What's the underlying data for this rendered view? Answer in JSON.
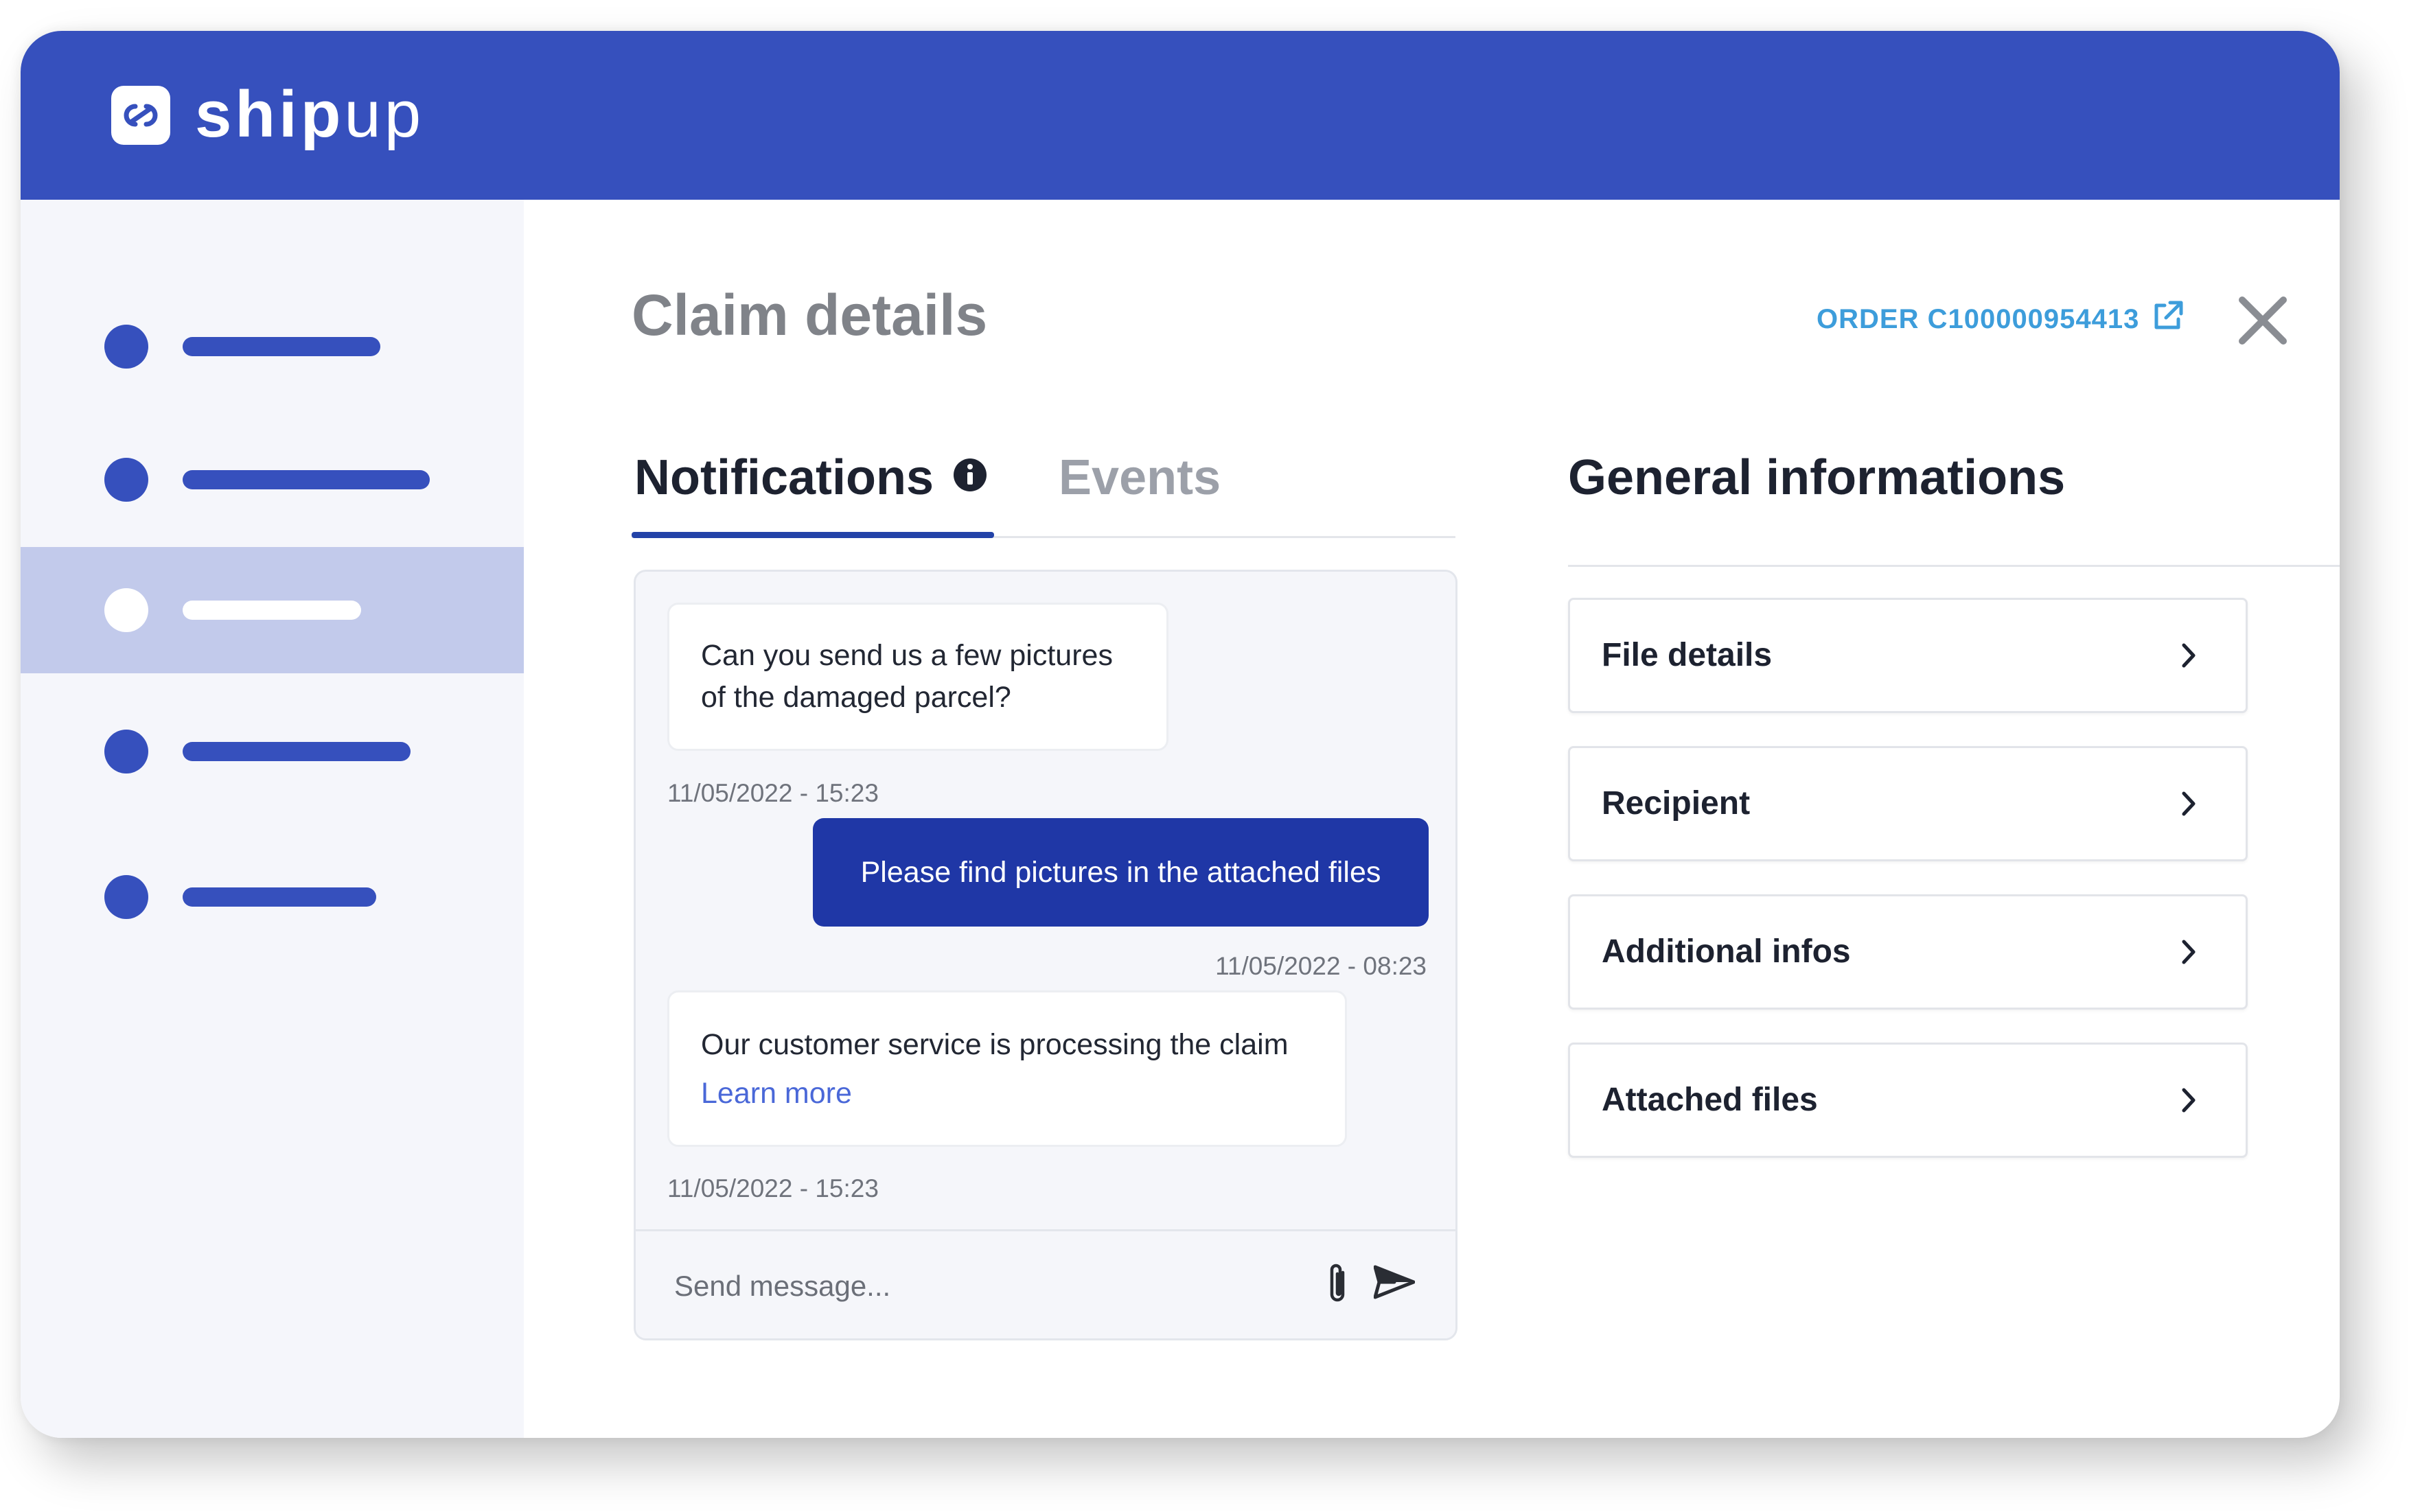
{
  "brand": {
    "name_bold": "ship",
    "name_light": "up",
    "primary_color": "#3650bd",
    "accent_color": "#1f37a6"
  },
  "sidebar": {
    "active_index": 2,
    "items": [
      {
        "icon": "dot"
      },
      {
        "icon": "dot"
      },
      {
        "icon": "dot"
      },
      {
        "icon": "dot"
      },
      {
        "icon": "dot"
      }
    ]
  },
  "page": {
    "title": "Claim details",
    "order_link": "ORDER C100000954413",
    "icons": {
      "external": "external-link-icon",
      "close": "close-icon"
    }
  },
  "tabs": {
    "active": "Notifications",
    "items": [
      {
        "label": "Notifications"
      },
      {
        "label": "Events"
      }
    ]
  },
  "chat": {
    "messages": [
      {
        "direction": "incoming",
        "lines": [
          "Can you send us a few pictures",
          "of the damaged parcel?"
        ],
        "timestamp": "11/05/2022 - 15:23"
      },
      {
        "direction": "outgoing",
        "text": "Please find pictures in the attached files",
        "timestamp": "11/05/2022 - 08:23"
      },
      {
        "direction": "incoming",
        "text": "Our customer service is processing the claim",
        "link": "Learn more",
        "timestamp": "11/05/2022 - 15:23"
      }
    ],
    "input_placeholder": "Send message...",
    "icons": {
      "attach": "paperclip-icon",
      "send": "send-icon"
    }
  },
  "general": {
    "title": "General informations",
    "cards": [
      {
        "label": "File details"
      },
      {
        "label": "Recipient"
      },
      {
        "label": "Additional infos"
      },
      {
        "label": "Attached files"
      }
    ]
  }
}
